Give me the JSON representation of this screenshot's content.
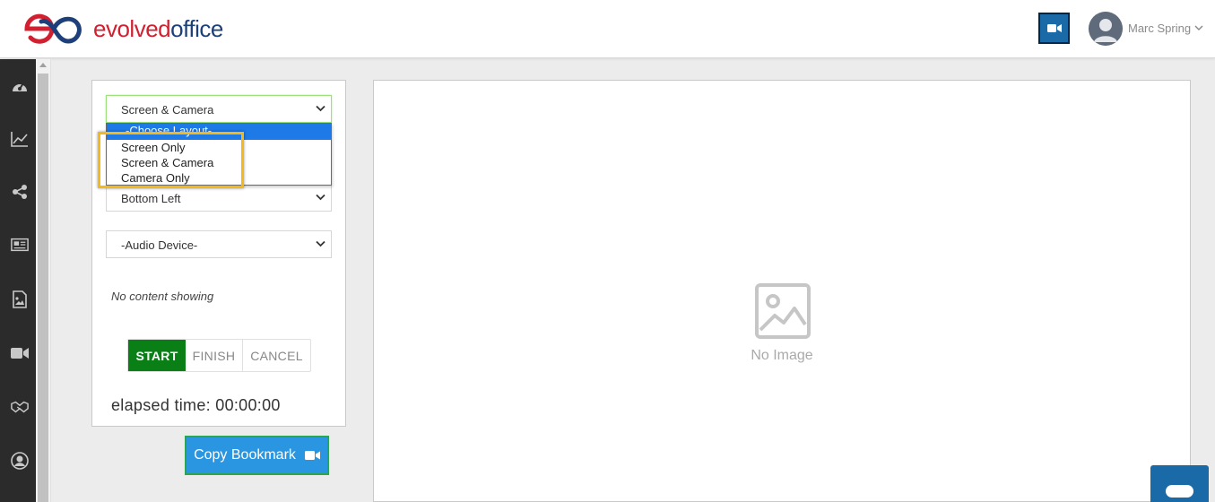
{
  "brand": {
    "logo_part1": "evolved",
    "logo_part2": "office",
    "colors": {
      "red": "#d12030",
      "navy": "#1d3f7a"
    }
  },
  "header": {
    "camera_icon": "video-camera-icon",
    "user_name": "Marc Spring"
  },
  "sidebar": {
    "icons": [
      "dashboard-icon",
      "analytics-icon",
      "share-icon",
      "newspaper-icon",
      "image-icon",
      "video-camera-icon",
      "handshake-icon",
      "user-circle-icon"
    ]
  },
  "panel": {
    "layout_select": {
      "value": "Screen & Camera"
    },
    "layout_options": [
      "-Choose Layout-",
      "Screen Only",
      "Screen & Camera",
      "Camera Only"
    ],
    "position_select": {
      "value": "Bottom Left"
    },
    "audio_select": {
      "value": "-Audio Device-"
    },
    "status": "No content showing",
    "buttons": {
      "start": "START",
      "finish": "FINISH",
      "cancel": "CANCEL"
    },
    "elapsed": "elapsed time: 00:00:00"
  },
  "copy_bookmark": {
    "label": "Copy Bookmark"
  },
  "preview": {
    "placeholder": "No Image"
  },
  "accent_colors": {
    "start_green": "#0a7f16",
    "copy_blue": "#2a95e0",
    "header_blue": "#1b6aa8",
    "highlight": "#f2b81c"
  }
}
